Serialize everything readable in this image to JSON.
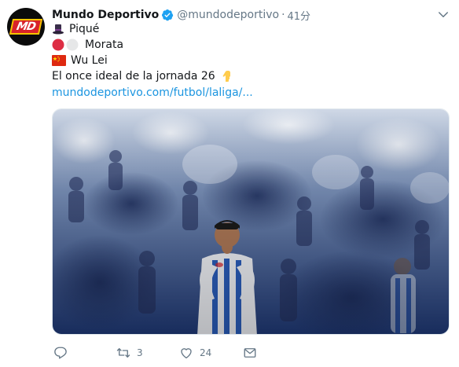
{
  "tweet": {
    "author_name": "Mundo Deportivo",
    "handle": "@mundodeportivo",
    "separator": "·",
    "time": "41分",
    "avatar_text": "MD",
    "lines": [
      {
        "emoji": "top-hat",
        "text": "Piqué"
      },
      {
        "emoji": "red-white-circles",
        "text": "Morata"
      },
      {
        "emoji": "china-flag",
        "text": "Wu Lei"
      },
      {
        "emoji": "",
        "text": "El once ideal de la jornada 26"
      },
      {
        "emoji": "",
        "text": "mundodeportivo.com/futbol/laliga/..."
      }
    ],
    "line4_trailing_emoji": "pointing-down-hand",
    "link_color": "#1b95e0"
  },
  "actions": {
    "reply_count": "",
    "retweet_count": "3",
    "like_count": "24"
  },
  "icons": {
    "verified": "verified-badge-icon",
    "caret": "chevron-down-icon",
    "reply": "reply-icon",
    "retweet": "retweet-icon",
    "like": "heart-icon",
    "dm": "envelope-icon"
  },
  "colors": {
    "text": "#14171a",
    "muted": "#657786",
    "verified": "#1da1f2",
    "brand_red": "#d8232a"
  }
}
